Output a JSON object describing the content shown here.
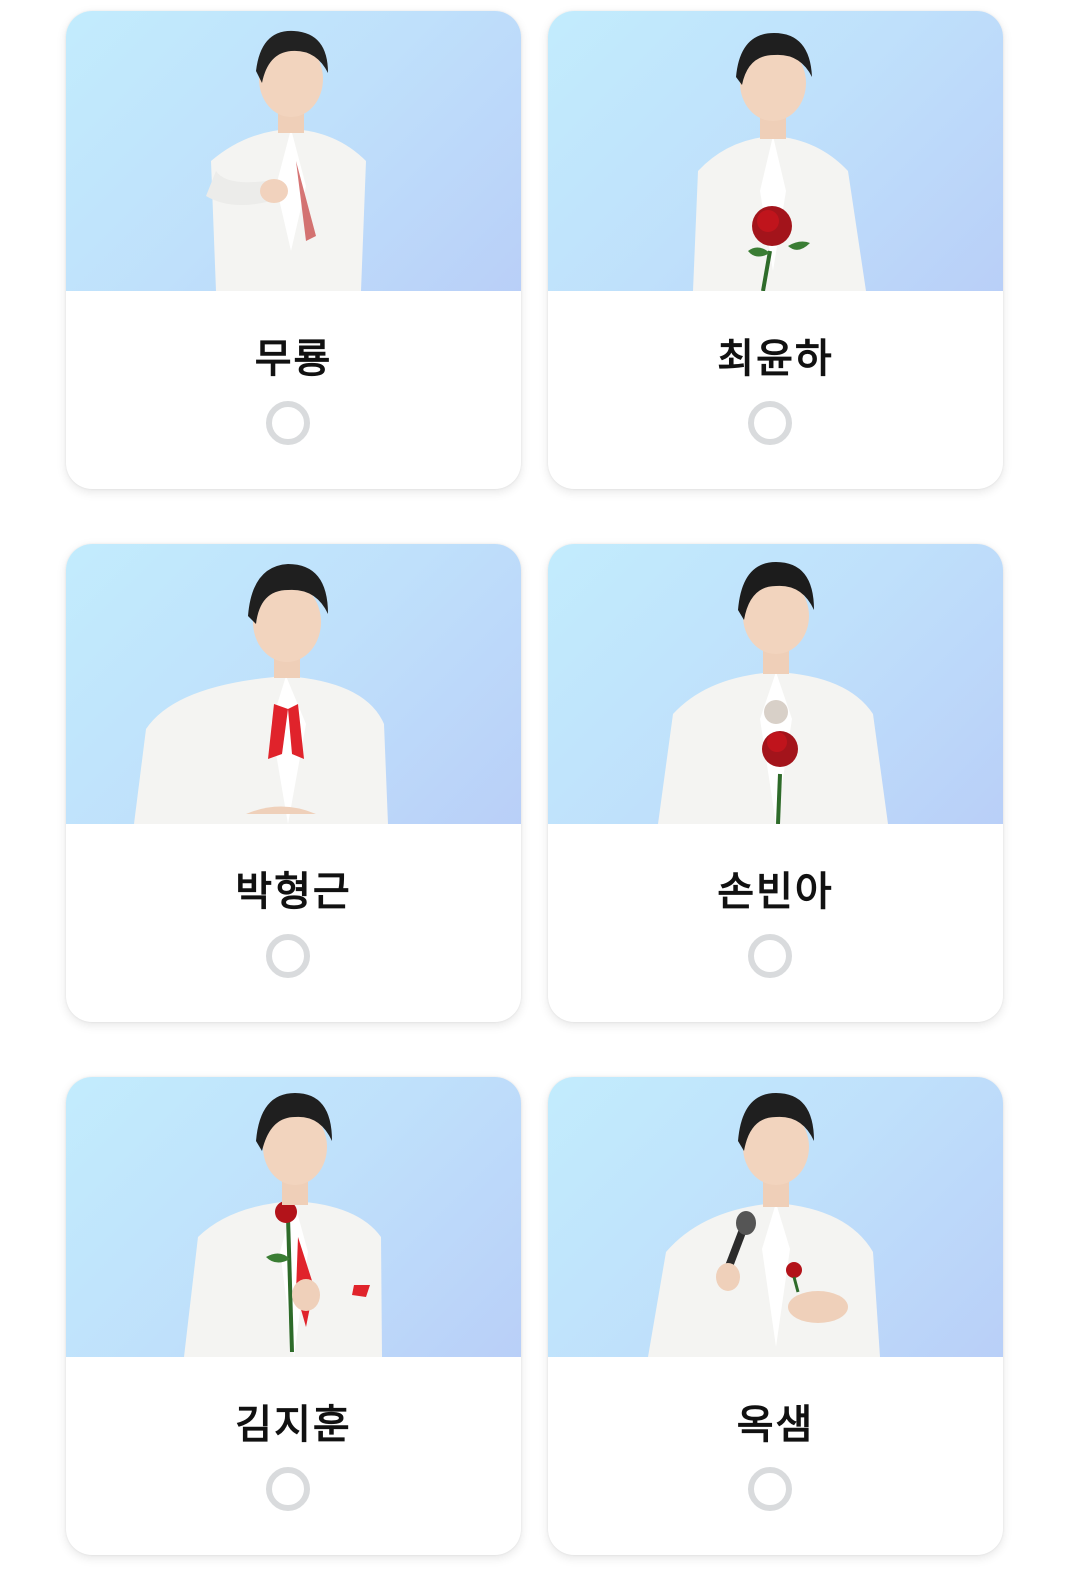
{
  "candidates": [
    {
      "name": "무룡",
      "photo": "singer-photo-finger-heart",
      "selected": false
    },
    {
      "name": "최윤하",
      "photo": "singer-photo-holding-rose",
      "selected": false
    },
    {
      "name": "박형근",
      "photo": "singer-photo-winking",
      "selected": false
    },
    {
      "name": "손빈아",
      "photo": "singer-photo-rose-chest",
      "selected": false
    },
    {
      "name": "김지훈",
      "photo": "singer-photo-rose-raised",
      "selected": false
    },
    {
      "name": "옥샘",
      "photo": "singer-photo-microphone",
      "selected": false
    }
  ],
  "colors": {
    "photo_bg_start": "#c2ecfd",
    "photo_bg_end": "#b9cff8",
    "radio_border": "#d9dbdd",
    "name_text": "#111111",
    "rose": "#c0141c"
  }
}
